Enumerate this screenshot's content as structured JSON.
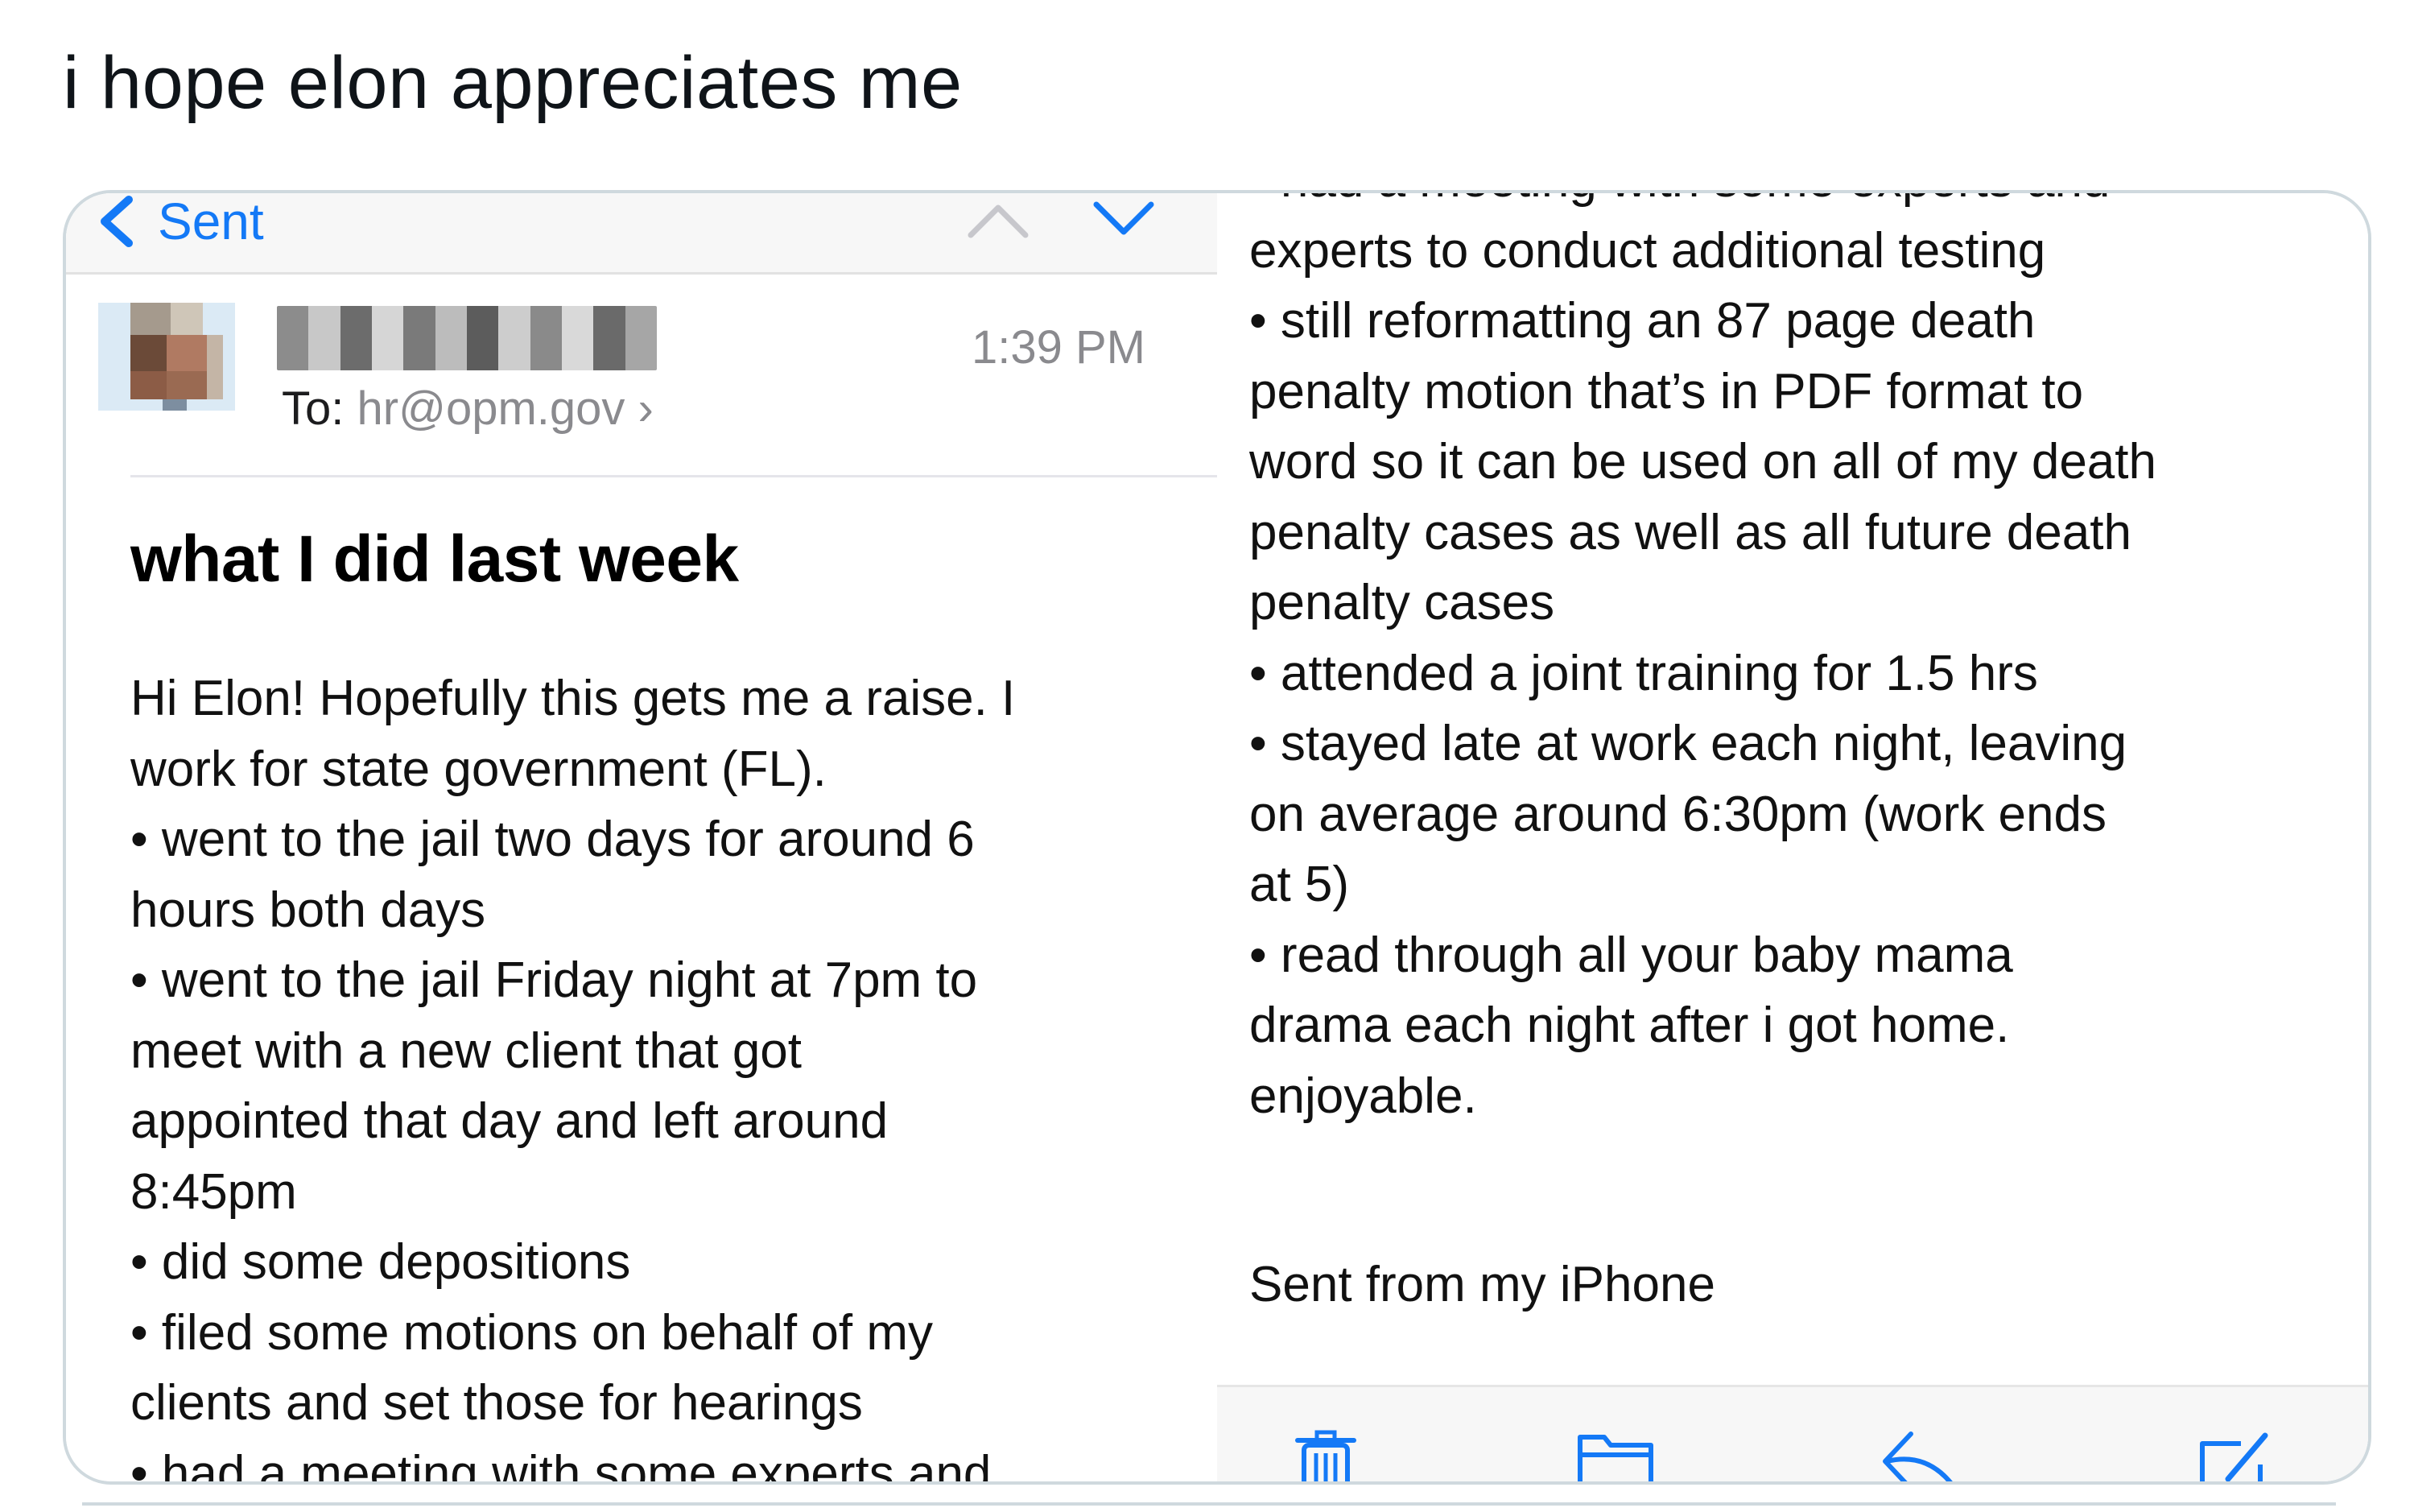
{
  "tweet": {
    "text": "i hope elon appreciates me"
  },
  "mail_nav": {
    "back_label": "Sent"
  },
  "header": {
    "time": "1:39 PM",
    "to_label": "To:",
    "to_address": "hr@opm.gov",
    "chevron": "›"
  },
  "subject": "what I did last week",
  "body_left": [
    "Hi Elon! Hopefully this gets me a raise. I",
    "work for state government (FL).",
    "• went to the jail two days for around 6",
    "hours both days",
    "• went to the jail Friday night at 7pm to",
    "meet with a new client that got",
    "appointed that day and left around",
    "8:45pm",
    "• did some depositions",
    "• filed some motions on behalf of my",
    "clients and set those for hearings",
    "• had a meeting with some experts and"
  ],
  "body_right": [
    "• had a meeting with some experts and",
    "experts to conduct additional testing",
    "• still reformatting an 87 page death",
    "penalty motion that’s in PDF format to",
    "word so it can be used on all of my death",
    "penalty cases as well as all future death",
    "penalty cases",
    "• attended a joint training for 1.5 hrs",
    "• stayed late at work each night, leaving",
    "on average around 6:30pm (work ends",
    "at 5)",
    "• read through all your baby mama",
    "drama each night after i got home.",
    "enjoyable."
  ],
  "signature": "Sent from my iPhone",
  "icons": {
    "back": "chevron-left-icon",
    "up": "chevron-up-icon",
    "down": "chevron-down-icon",
    "trash": "trash-icon",
    "folder": "folder-icon",
    "reply": "reply-icon",
    "compose": "compose-icon"
  },
  "colors": {
    "ios_blue": "#1479f6",
    "meta_gray": "#8a8a8e",
    "border": "#cfd9de"
  }
}
